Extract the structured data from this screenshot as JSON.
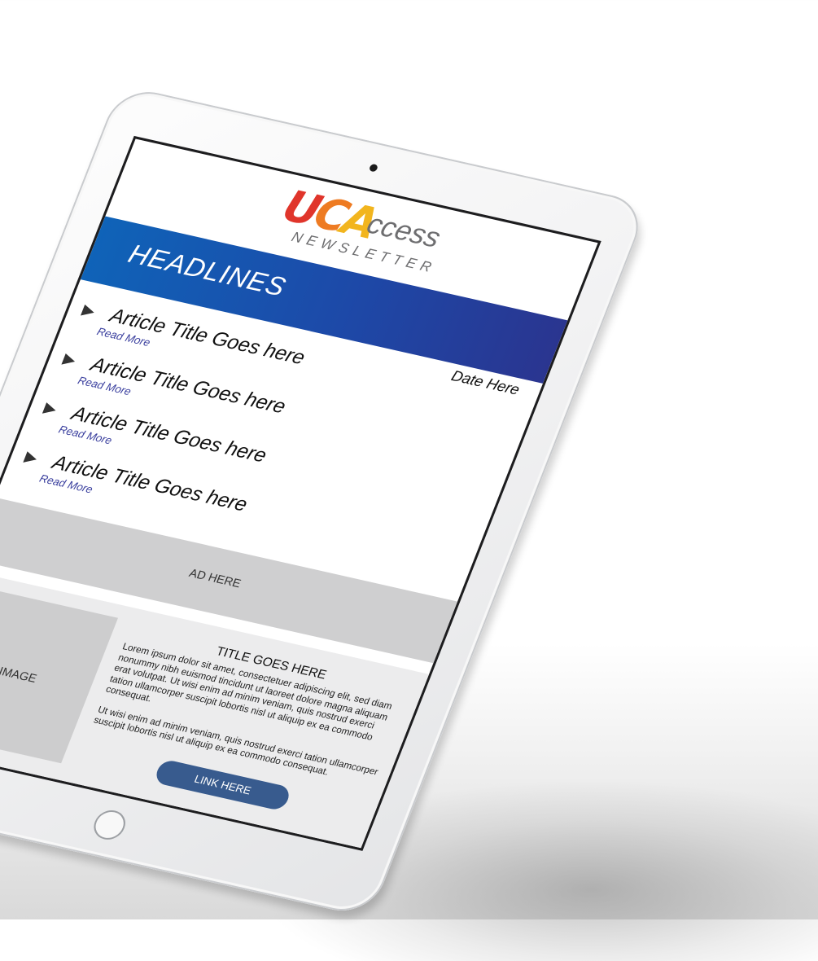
{
  "newsletter": {
    "logo": {
      "mark": [
        "U",
        "C",
        "A"
      ],
      "wordmark": "ccess",
      "subtitle": "NEWSLETTER"
    },
    "headlines_title": "HEADLINES",
    "date": "Date Here",
    "articles": [
      {
        "title": "Article Title Goes here",
        "read_more": "Read More"
      },
      {
        "title": "Article Title Goes here",
        "read_more": "Read More"
      },
      {
        "title": "Article Title Goes here",
        "read_more": "Read More"
      },
      {
        "title": "Article Title Goes here",
        "read_more": "Read More"
      }
    ],
    "ad_label": "AD HERE",
    "feature": {
      "image_label": "IMAGE",
      "title": "TITLE GOES HERE",
      "paragraph_1": "Lorem ipsum dolor sit amet, consectetuer adipiscing elit, sed diam nonummy nibh euismod tincidunt ut laoreet dolore magna aliquam erat volutpat. Ut wisi enim ad minim veniam, quis nostrud exerci tation ullamcorper suscipit lobortis nisl ut aliquip ex ea commodo consequat.",
      "paragraph_2": "Ut wisi enim ad minim veniam, quis nostrud exerci tation ullamcorper suscipit lobortis nisl ut aliquip ex ea commodo consequat.",
      "link_label": "LINK HERE"
    }
  },
  "colors": {
    "banner_start": "#0f63b8",
    "banner_end": "#2a3590",
    "logo_red": "#e0352b",
    "logo_orange": "#ee7b22",
    "logo_yellow": "#f2b51e",
    "read_more": "#3a3f9e",
    "link_button": "#385b8e",
    "placeholder_gray": "#cdcdce"
  },
  "icons": {
    "bullet": "arrow-bullet-icon",
    "camera": "front-camera-icon",
    "home": "home-button-icon"
  }
}
